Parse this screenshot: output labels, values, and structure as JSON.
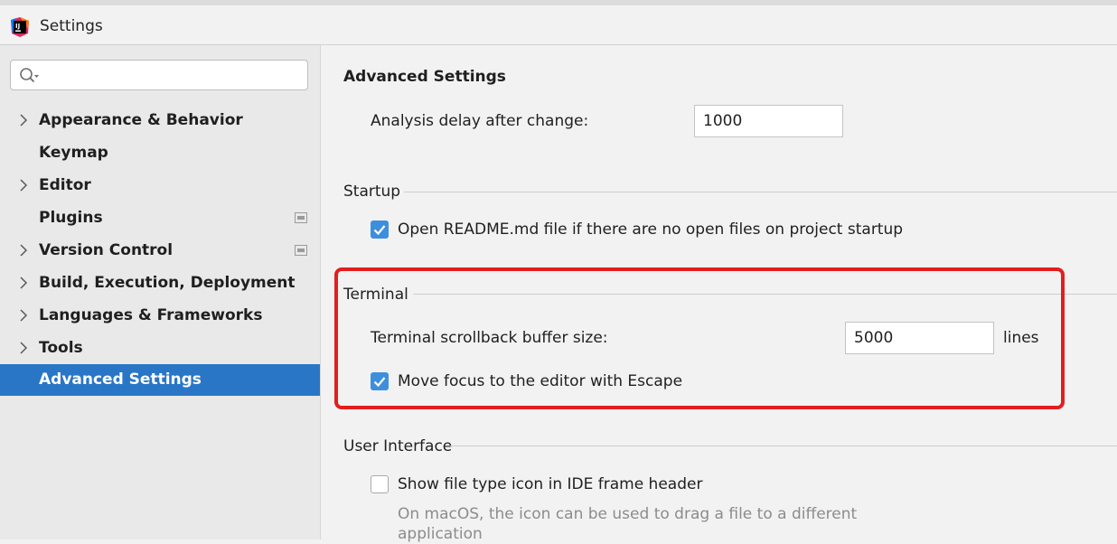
{
  "window": {
    "title": "Settings",
    "logo_text": "IJ"
  },
  "search": {
    "value": "",
    "placeholder": ""
  },
  "sidebar": {
    "items": [
      {
        "label": "Appearance & Behavior",
        "expandable": true
      },
      {
        "label": "Keymap",
        "expandable": false
      },
      {
        "label": "Editor",
        "expandable": true
      },
      {
        "label": "Plugins",
        "expandable": false
      },
      {
        "label": "Version Control",
        "expandable": true
      },
      {
        "label": "Build, Execution, Deployment",
        "expandable": true
      },
      {
        "label": "Languages & Frameworks",
        "expandable": true
      },
      {
        "label": "Tools",
        "expandable": true
      },
      {
        "label": "Advanced Settings",
        "expandable": false,
        "selected": true
      }
    ]
  },
  "main": {
    "title": "Advanced Settings",
    "analysis_delay": {
      "label": "Analysis delay after change:",
      "value": "1000"
    },
    "startup": {
      "title": "Startup",
      "open_readme": {
        "label": "Open README.md file if there are no open files on project startup",
        "checked": true
      }
    },
    "terminal": {
      "title": "Terminal",
      "scrollback": {
        "label": "Terminal scrollback buffer size:",
        "value": "5000",
        "unit": "lines"
      },
      "move_focus": {
        "label": "Move focus to the editor with Escape",
        "checked": true
      }
    },
    "user_interface": {
      "title": "User Interface",
      "file_type_icon": {
        "label": "Show file type icon in IDE frame header",
        "checked": false,
        "hint": "On macOS, the icon can be used to drag a file to a different application"
      }
    }
  },
  "colors": {
    "selection": "#2a76c6",
    "checkbox": "#3d8fde",
    "highlight_border": "#e31e1e"
  }
}
